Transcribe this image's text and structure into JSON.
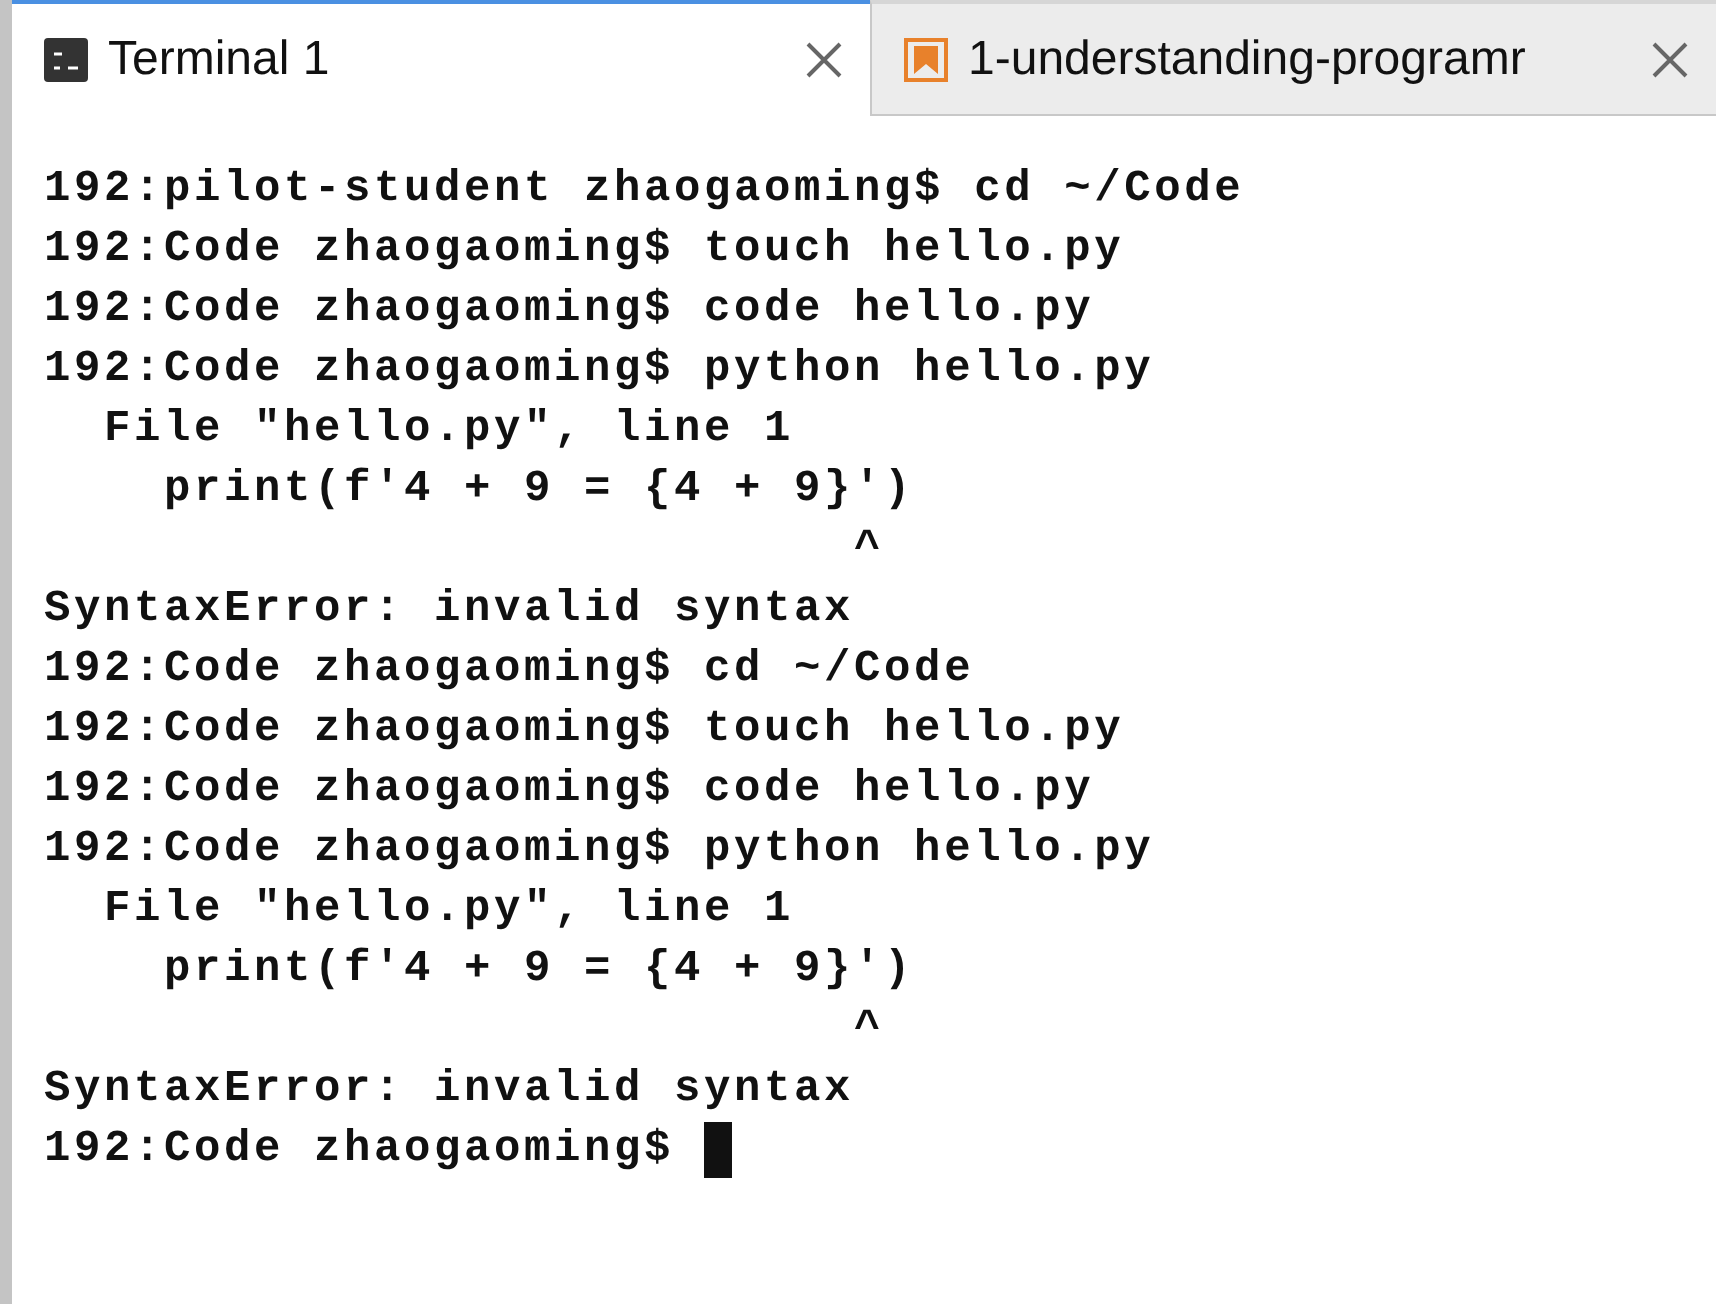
{
  "tabs": [
    {
      "label": "Terminal 1",
      "kind": "terminal",
      "selected": true
    },
    {
      "label": "1-understanding-programr",
      "kind": "document",
      "selected": false
    }
  ],
  "terminal": {
    "lines": [
      "192:pilot-student zhaogaoming$ cd ~/Code",
      "192:Code zhaogaoming$ touch hello.py",
      "192:Code zhaogaoming$ code hello.py",
      "192:Code zhaogaoming$ python hello.py",
      "  File \"hello.py\", line 1",
      "    print(f'4 + 9 = {4 + 9}')",
      "                           ^",
      "SyntaxError: invalid syntax",
      "192:Code zhaogaoming$ cd ~/Code",
      "192:Code zhaogaoming$ touch hello.py",
      "192:Code zhaogaoming$ code hello.py",
      "192:Code zhaogaoming$ python hello.py",
      "  File \"hello.py\", line 1",
      "    print(f'4 + 9 = {4 + 9}')",
      "                           ^",
      "SyntaxError: invalid syntax"
    ],
    "prompt": "192:Code zhaogaoming$"
  }
}
